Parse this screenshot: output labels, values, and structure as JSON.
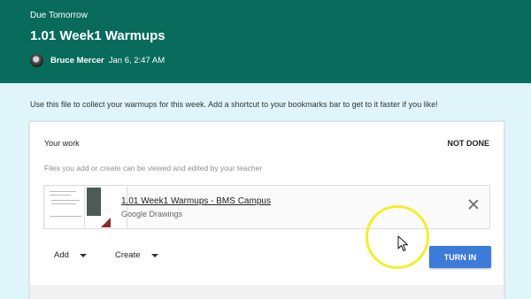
{
  "header": {
    "due": "Due Tomorrow",
    "title": "1.01 Week1 Warmups",
    "author": "Bruce Mercer",
    "date": "Jan 6, 2:47 AM"
  },
  "description": "Use this file to collect your warmups for this week. Add a shortcut to your bookmarks bar to get to it faster if you like!",
  "work": {
    "heading": "Your work",
    "status": "NOT DONE",
    "hint": "Files you add or create can be viewed and edited by your teacher",
    "attachment": {
      "name": "1.01 Week1 Warmups - BMS Campus",
      "type": "Google Drawings"
    },
    "add_label": "Add",
    "create_label": "Create",
    "turn_in_label": "TURN IN"
  },
  "colors": {
    "header_bg": "#086b5c",
    "page_bg": "#e0f5f9",
    "turn_in_bg": "#3d7bd9",
    "highlight": "#f2ee2e"
  }
}
